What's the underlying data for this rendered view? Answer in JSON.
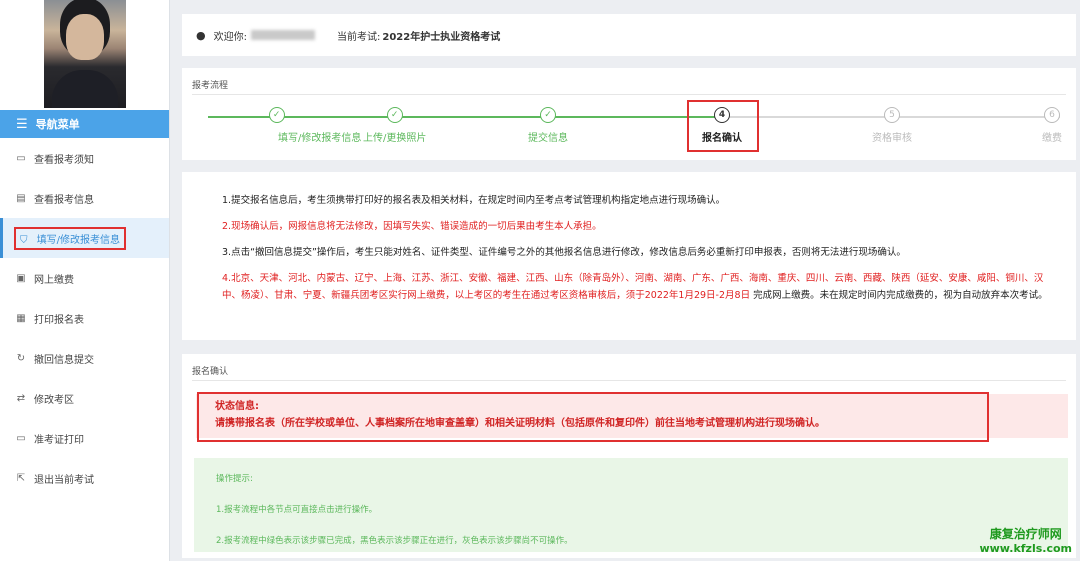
{
  "sidebar": {
    "menu_title": "导航菜单",
    "items": [
      {
        "label": "查看报考须知",
        "icon": "message-icon"
      },
      {
        "label": "查看报考信息",
        "icon": "document-icon"
      },
      {
        "label": "填写/修改报考信息",
        "icon": "shield-check-icon"
      },
      {
        "label": "网上缴费",
        "icon": "payment-icon"
      },
      {
        "label": "打印报名表",
        "icon": "print-form-icon"
      },
      {
        "label": "撤回信息提交",
        "icon": "undo-icon"
      },
      {
        "label": "修改考区",
        "icon": "swap-icon"
      },
      {
        "label": "准考证打印",
        "icon": "id-card-icon"
      },
      {
        "label": "退出当前考试",
        "icon": "exit-icon"
      }
    ]
  },
  "header": {
    "welcome_label": "欢迎你:",
    "current_exam_label": "当前考试:",
    "current_exam": "2022年护士执业资格考试"
  },
  "process": {
    "title": "报考流程",
    "steps": [
      {
        "number": "✓",
        "label": "填写/修改报考信息",
        "state": "done"
      },
      {
        "number": "✓",
        "label": "上传/更换照片",
        "state": "done"
      },
      {
        "number": "✓",
        "label": "提交信息",
        "state": "done"
      },
      {
        "number": "4",
        "label": "报名确认",
        "state": "current"
      },
      {
        "number": "5",
        "label": "资格审核",
        "state": "future"
      },
      {
        "number": "6",
        "label": "缴费",
        "state": "future"
      }
    ]
  },
  "notice": {
    "item1": "1.提交报名信息后，考生须携带打印好的报名表及相关材料，在规定时间内至考点考试管理机构指定地点进行现场确认。",
    "item2": "2.现场确认后，网报信息将无法修改，因填写失实、错误造成的一切后果由考生本人承担。",
    "item3": "3.点击“撤回信息提交”操作后，考生只能对姓名、证件类型、证件编号之外的其他报名信息进行修改，修改信息后务必重新打印申报表，否则将无法进行现场确认。",
    "item4_red": "4.北京、天津、河北、内蒙古、辽宁、上海、江苏、浙江、安徽、福建、江西、山东（除青岛外）、河南、湖南、广东、广西、海南、重庆、四川、云南、西藏、陕西（延安、安康、咸阳、铜川、汉中、杨凌）、甘肃、宁夏、新疆兵团考区实行网上缴费，以上考区的考生在通过考区资格审核后，须于2022年1月29日-2月8日",
    "item4_black": "完成网上缴费。未在规定时间内完成缴费的，视为自动放弃本次考试。"
  },
  "confirm": {
    "title": "报名确认",
    "status_label": "状态信息:",
    "status_text": "请携带报名表（所在学校或单位、人事档案所在地审查盖章）和相关证明材料（包括原件和复印件）前往当地考试管理机构进行现场确认。",
    "tips_title": "操作提示:",
    "tip1": "1.报考流程中各节点可直接点击进行操作。",
    "tip2": "2.报考流程中绿色表示该步骤已完成，黑色表示该步骤正在进行，灰色表示该步骤尚不可操作。"
  },
  "watermark": {
    "line1": "康复治疗师网",
    "line2": "www.kfzls.com"
  },
  "colors": {
    "accent": "#4ba3e8",
    "done": "#5cb85c",
    "highlight": "#e03030"
  }
}
